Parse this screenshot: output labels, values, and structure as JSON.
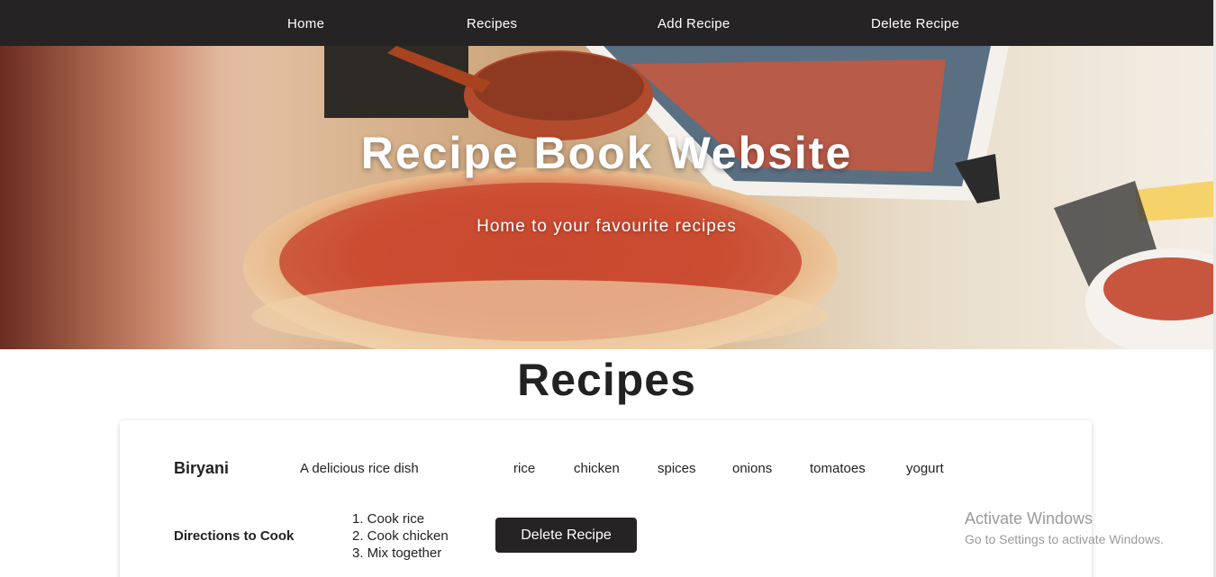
{
  "nav": {
    "items": [
      "Home",
      "Recipes",
      "Add Recipe",
      "Delete Recipe"
    ]
  },
  "hero": {
    "title": "Recipe Book Website",
    "subtitle": "Home to your favourite recipes"
  },
  "section": {
    "title": "Recipes"
  },
  "recipe": {
    "name": "Biryani",
    "description": "A delicious rice dish",
    "ingredients": [
      "rice",
      "chicken",
      "spices",
      "onions",
      "tomatoes",
      "yogurt"
    ],
    "directions_label": "Directions to Cook",
    "steps": [
      "1. Cook rice",
      "2. Cook chicken",
      "3. Mix together"
    ],
    "delete_label": "Delete Recipe"
  },
  "watermark": {
    "title": "Activate Windows",
    "subtitle": "Go to Settings to activate Windows."
  },
  "colors": {
    "nav_bg": "#252323",
    "button_bg": "#252323",
    "text": "#222222"
  }
}
